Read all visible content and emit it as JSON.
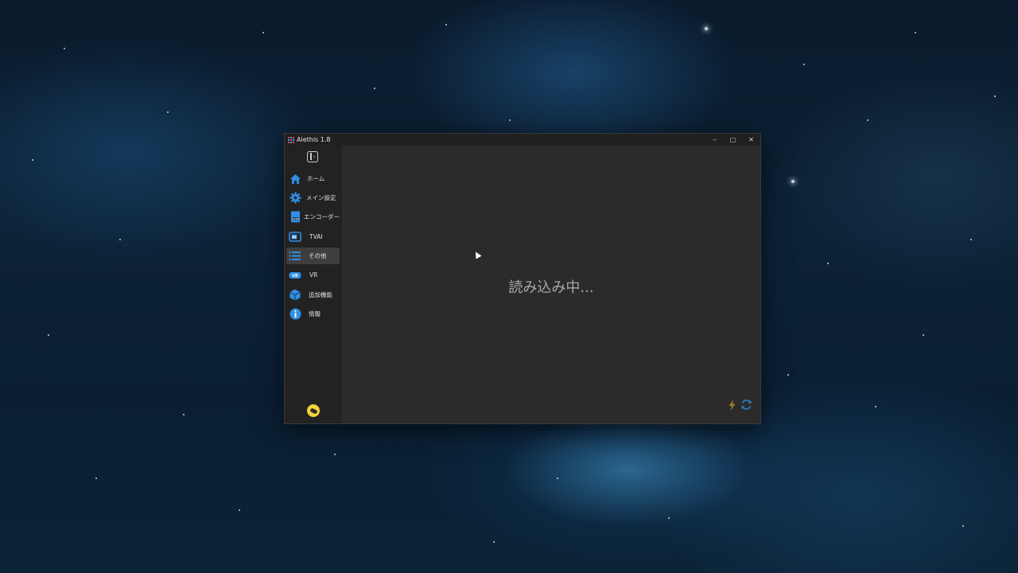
{
  "window": {
    "title": "Alethis 1.8",
    "minimize_glyph": "–",
    "maximize_glyph": "▢",
    "close_glyph": "✕"
  },
  "sidebar": {
    "collapse_icon": "sidebar-collapse-icon",
    "items": [
      {
        "label": "ホーム",
        "icon": "home-icon",
        "active": false
      },
      {
        "label": "メイン設定",
        "icon": "gear-icon",
        "active": false
      },
      {
        "label": "エンコーダー",
        "icon": "h264-file-icon",
        "active": false
      },
      {
        "label": "TVAI",
        "icon": "ai-chip-icon",
        "active": false
      },
      {
        "label": "その他",
        "icon": "list-icon",
        "active": true
      },
      {
        "label": "VR",
        "icon": "vr-icon",
        "active": false
      },
      {
        "label": "追加機能",
        "icon": "cube-icon",
        "active": false
      },
      {
        "label": "情報",
        "icon": "info-icon",
        "active": false
      }
    ],
    "avatar_icon": "avatar-icon"
  },
  "content": {
    "status_text": "読み込み中...",
    "bottom_icons": [
      "lightning-icon",
      "refresh-icon"
    ]
  },
  "colors": {
    "accent": "#2f8fe6",
    "window_bg": "#2b2b2b",
    "sidebar_bg": "#222222",
    "titlebar_bg": "#202020",
    "active_item_bg": "#3e3e3e",
    "lightning": "#c99a2c"
  }
}
